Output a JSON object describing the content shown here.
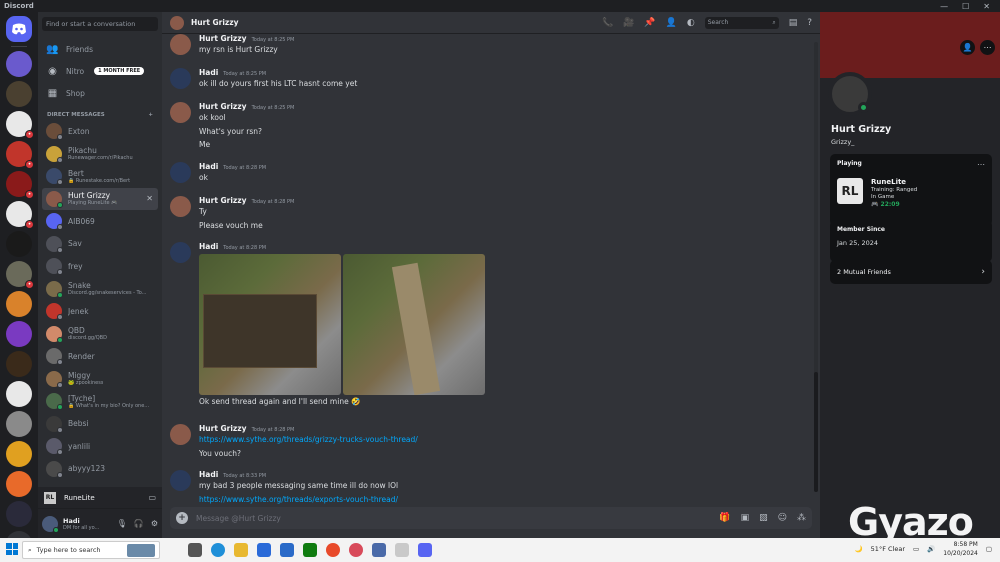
{
  "app": {
    "title": "Discord"
  },
  "window": {
    "minimize": "—",
    "maximize": "☐",
    "close": "✕"
  },
  "sidebar_search": {
    "placeholder": "Find or start a conversation"
  },
  "nav": {
    "friends": "Friends",
    "nitro": "Nitro",
    "nitro_badge": "1 MONTH FREE",
    "shop": "Shop"
  },
  "dm_header": {
    "label": "DIRECT MESSAGES",
    "add": "+"
  },
  "dms": [
    {
      "name": "Exton",
      "sub": "",
      "color": "#6a4d3a",
      "status": "#80848e"
    },
    {
      "name": "Pikachu",
      "sub": "Runewager.com/r/Pikachu",
      "color": "#c9a23a",
      "status": "#80848e"
    },
    {
      "name": "Bert",
      "sub": "🔒 Runestake.com/r/Bert",
      "color": "#3a4a6a",
      "status": "#80848e"
    },
    {
      "name": "Hurt Grizzy",
      "sub": "Playing RuneLite 🎮",
      "color": "#8a5a4a",
      "status": "#23a55a",
      "active": true
    },
    {
      "name": "AIB069",
      "sub": "",
      "color": "#5865f2",
      "status": "#80848e"
    },
    {
      "name": "Sav",
      "sub": "",
      "color": "#4e5058",
      "status": "#80848e"
    },
    {
      "name": "frey",
      "sub": "",
      "color": "#4e5058",
      "status": "#80848e"
    },
    {
      "name": "Snake",
      "sub": "Discord.gg/snakeservices - To...",
      "color": "#7a6b4a",
      "status": "#23a55a"
    },
    {
      "name": "Jenek",
      "sub": "",
      "color": "#c1352b",
      "status": "#80848e"
    },
    {
      "name": "QBD",
      "sub": "discord.gg/QBD",
      "color": "#d28a6a",
      "status": "#23a55a"
    },
    {
      "name": "Render",
      "sub": "",
      "color": "#6a6a6a",
      "status": "#80848e"
    },
    {
      "name": "Miggy",
      "sub": "🐸 zpookiness",
      "color": "#8a6a4a",
      "status": "#80848e"
    },
    {
      "name": "[Tyche]",
      "sub": "🔒 What's in my bio? Only one...",
      "color": "#4a6a4a",
      "status": "#23a55a"
    },
    {
      "name": "Bebsi",
      "sub": "",
      "color": "#3a3a3a",
      "status": "#80848e"
    },
    {
      "name": "yanlili",
      "sub": "",
      "color": "#5a5a6a",
      "status": "#80848e"
    },
    {
      "name": "abyyy123",
      "sub": "",
      "color": "#4a4a4a",
      "status": "#80848e"
    }
  ],
  "activity_bar": {
    "icon_text": "RL",
    "label": "RuneLite"
  },
  "userbar": {
    "name": "Hadi",
    "status": "DM for all yo..."
  },
  "channel": {
    "name": "Hurt Grizzy"
  },
  "header_search": {
    "placeholder": "Search"
  },
  "messages": [
    {
      "author": "Hurt Grizzy",
      "time": "Today at 8:25 PM",
      "color": "#8a5a4a",
      "lines": [
        "my rsn is Hurt Grizzy"
      ]
    },
    {
      "author": "Hadi",
      "time": "Today at 8:25 PM",
      "color": "#2a3a5a",
      "lines": [
        "ok ill do yours first his LTC hasnt come yet"
      ]
    },
    {
      "author": "Hurt Grizzy",
      "time": "Today at 8:25 PM",
      "color": "#8a5a4a",
      "lines": [
        "ok kool",
        "What's your rsn?",
        "Me"
      ]
    },
    {
      "author": "Hadi",
      "time": "Today at 8:28 PM",
      "color": "#2a3a5a",
      "lines": [
        "ok"
      ]
    },
    {
      "author": "Hurt Grizzy",
      "time": "Today at 8:28 PM",
      "color": "#8a5a4a",
      "lines": [
        "Ty",
        "Please vouch me"
      ]
    },
    {
      "author": "Hadi",
      "time": "Today at 8:28 PM",
      "color": "#2a3a5a",
      "lines": [
        "Ok send thread again and I'll send mine 🤣"
      ]
    },
    {
      "author": "Hurt Grizzy",
      "time": "Today at 8:28 PM",
      "color": "#8a5a4a",
      "lines": [
        "https://www.sythe.org/threads/grizzy-trucks-vouch-thread/",
        "You vouch?"
      ]
    },
    {
      "author": "Hadi",
      "time": "Today at 8:33 PM",
      "color": "#2a3a5a",
      "lines": [
        "my bad 3 people messaging same time ill do now lOl",
        "https://www.sythe.org/threads/exports-vouch-thread/"
      ]
    }
  ],
  "composer": {
    "placeholder": "Message @Hurt Grizzy"
  },
  "profile": {
    "name": "Hurt Grizzy",
    "username": "Grizzy_",
    "playing_title": "Playing",
    "game": "RuneLite",
    "game_icon": "RL",
    "detail1": "Training: Ranged",
    "detail2": "In Game",
    "elapsed": "🎮 22:09",
    "member_since_title": "Member Since",
    "member_since": "Jan 25, 2024",
    "mutual": "2 Mutual Friends"
  },
  "taskbar": {
    "search": "Type here to search",
    "weather": "51°F Clear",
    "time": "8:58 PM",
    "date": "10/20/2024"
  },
  "watermark": "Gyazo"
}
